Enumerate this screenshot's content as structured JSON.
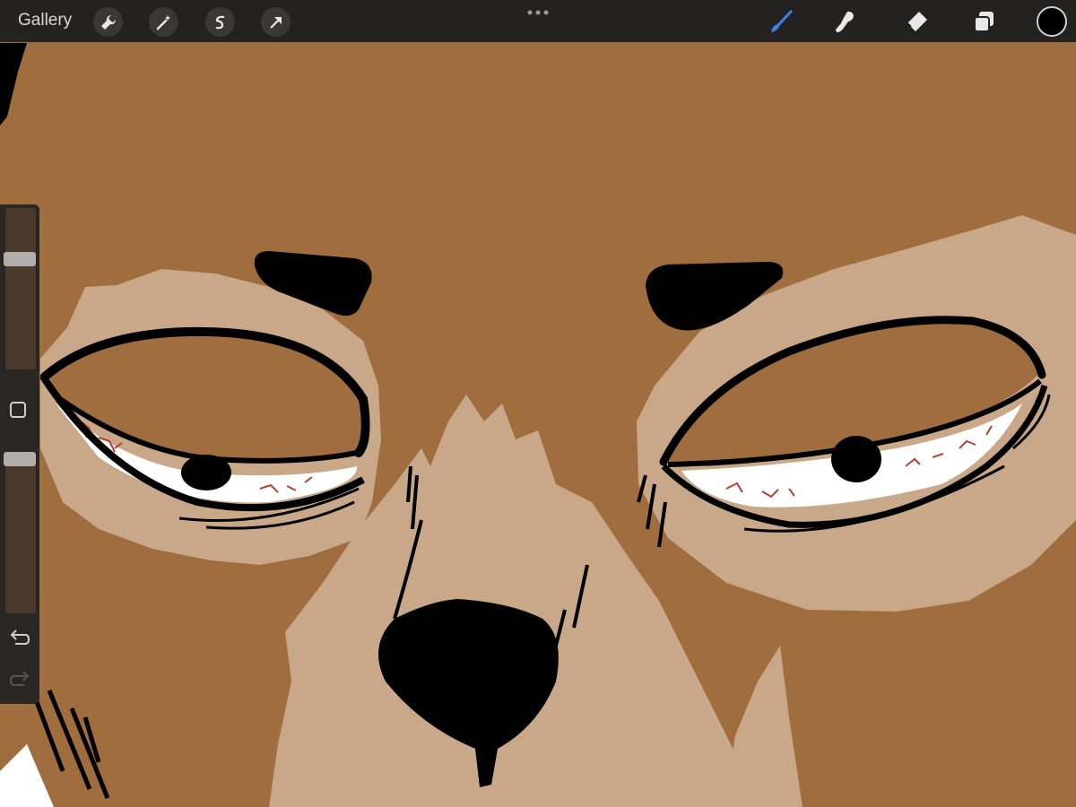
{
  "toolbar": {
    "gallery_label": "Gallery",
    "left_tools": [
      "wrench-icon",
      "magic-wand-icon",
      "selection-icon",
      "transform-arrow-icon"
    ],
    "right_tools": [
      "brush-icon",
      "smudge-icon",
      "eraser-icon",
      "layers-icon"
    ],
    "active_tool": "brush-icon",
    "accent_color": "#3e7ef0",
    "current_color": "#000000"
  },
  "sidebar": {
    "size_slider_value": 0.7,
    "opacity_slider_value": 1.0,
    "buttons": [
      "modifier-button",
      "undo-icon",
      "redo-icon"
    ]
  },
  "canvas": {
    "skin_color": "#a06d3e",
    "mask_color": "#c8a888",
    "ink_color": "#000000",
    "eye_white": "#ffffff",
    "vein_color": "#b4412e"
  }
}
